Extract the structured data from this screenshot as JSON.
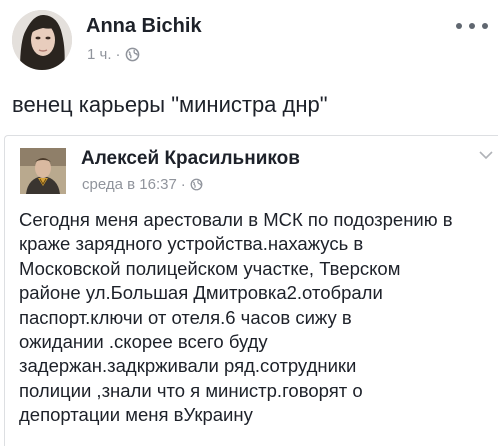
{
  "post": {
    "author": "Anna Bichik",
    "time": "1 ч.",
    "separator": "·",
    "privacy_icon": "globe-icon",
    "more_icon": "more-icon",
    "text": "венец карьеры \"министра днр\""
  },
  "shared_post": {
    "author": "Алексей Красильников",
    "time": "среда в 16:37",
    "separator": "·",
    "privacy_icon": "globe-icon",
    "chevron_icon": "chevron-down-icon",
    "lines": [
      "Сегодня меня арестовали в МСК по подозрению в",
      "краже зарядного устройства.нахажусь в",
      "Московской полицейском участке, Тверском",
      "районе ул.Большая Дмитровка2.отобрали",
      "паспорт.ключи от отеля.6 часов сижу в",
      "ожидании .скорее всего буду",
      "задержан.задкрживали ряд.сотрудники",
      "полиции ,знали что я министр.говорят о",
      "депортации меня вУкраину"
    ]
  }
}
